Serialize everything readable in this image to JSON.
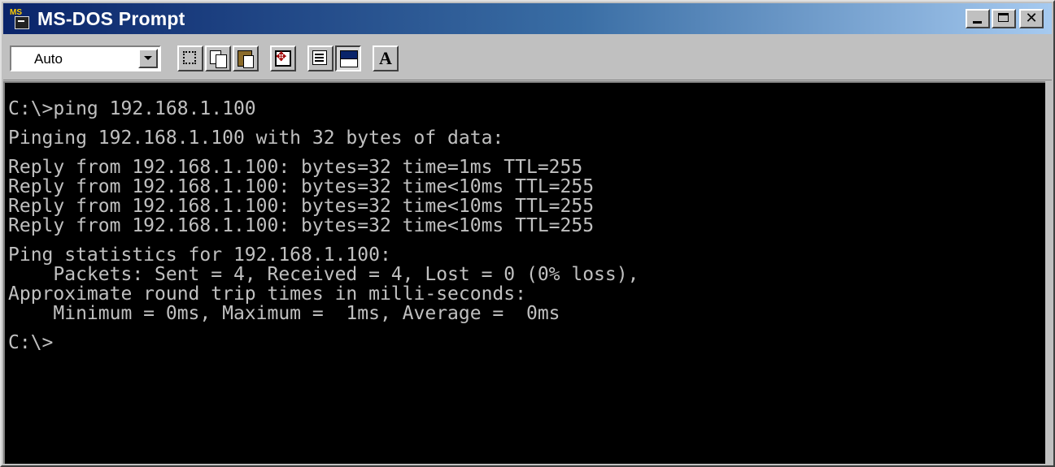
{
  "window": {
    "title": "MS-DOS Prompt",
    "icon": "msdos-icon"
  },
  "title_buttons": {
    "minimize": "minimize",
    "maximize": "maximize",
    "close": "close"
  },
  "toolbar": {
    "font_size": "Auto",
    "tools": [
      "mark",
      "copy",
      "paste",
      "full-screen",
      "properties",
      "background",
      "font"
    ]
  },
  "console": {
    "lines": [
      "C:\\>ping 192.168.1.100",
      "",
      "Pinging 192.168.1.100 with 32 bytes of data:",
      "",
      "Reply from 192.168.1.100: bytes=32 time=1ms TTL=255",
      "Reply from 192.168.1.100: bytes=32 time<10ms TTL=255",
      "Reply from 192.168.1.100: bytes=32 time<10ms TTL=255",
      "Reply from 192.168.1.100: bytes=32 time<10ms TTL=255",
      "",
      "Ping statistics for 192.168.1.100:",
      "    Packets: Sent = 4, Received = 4, Lost = 0 (0% loss),",
      "Approximate round trip times in milli-seconds:",
      "    Minimum = 0ms, Maximum =  1ms, Average =  0ms",
      "",
      "C:\\>"
    ]
  },
  "colors": {
    "titlebar_start": "#0a246a",
    "titlebar_end": "#a6caf0",
    "console_bg": "#000000",
    "console_fg": "#c0c0c0",
    "chrome": "#c0c0c0"
  }
}
